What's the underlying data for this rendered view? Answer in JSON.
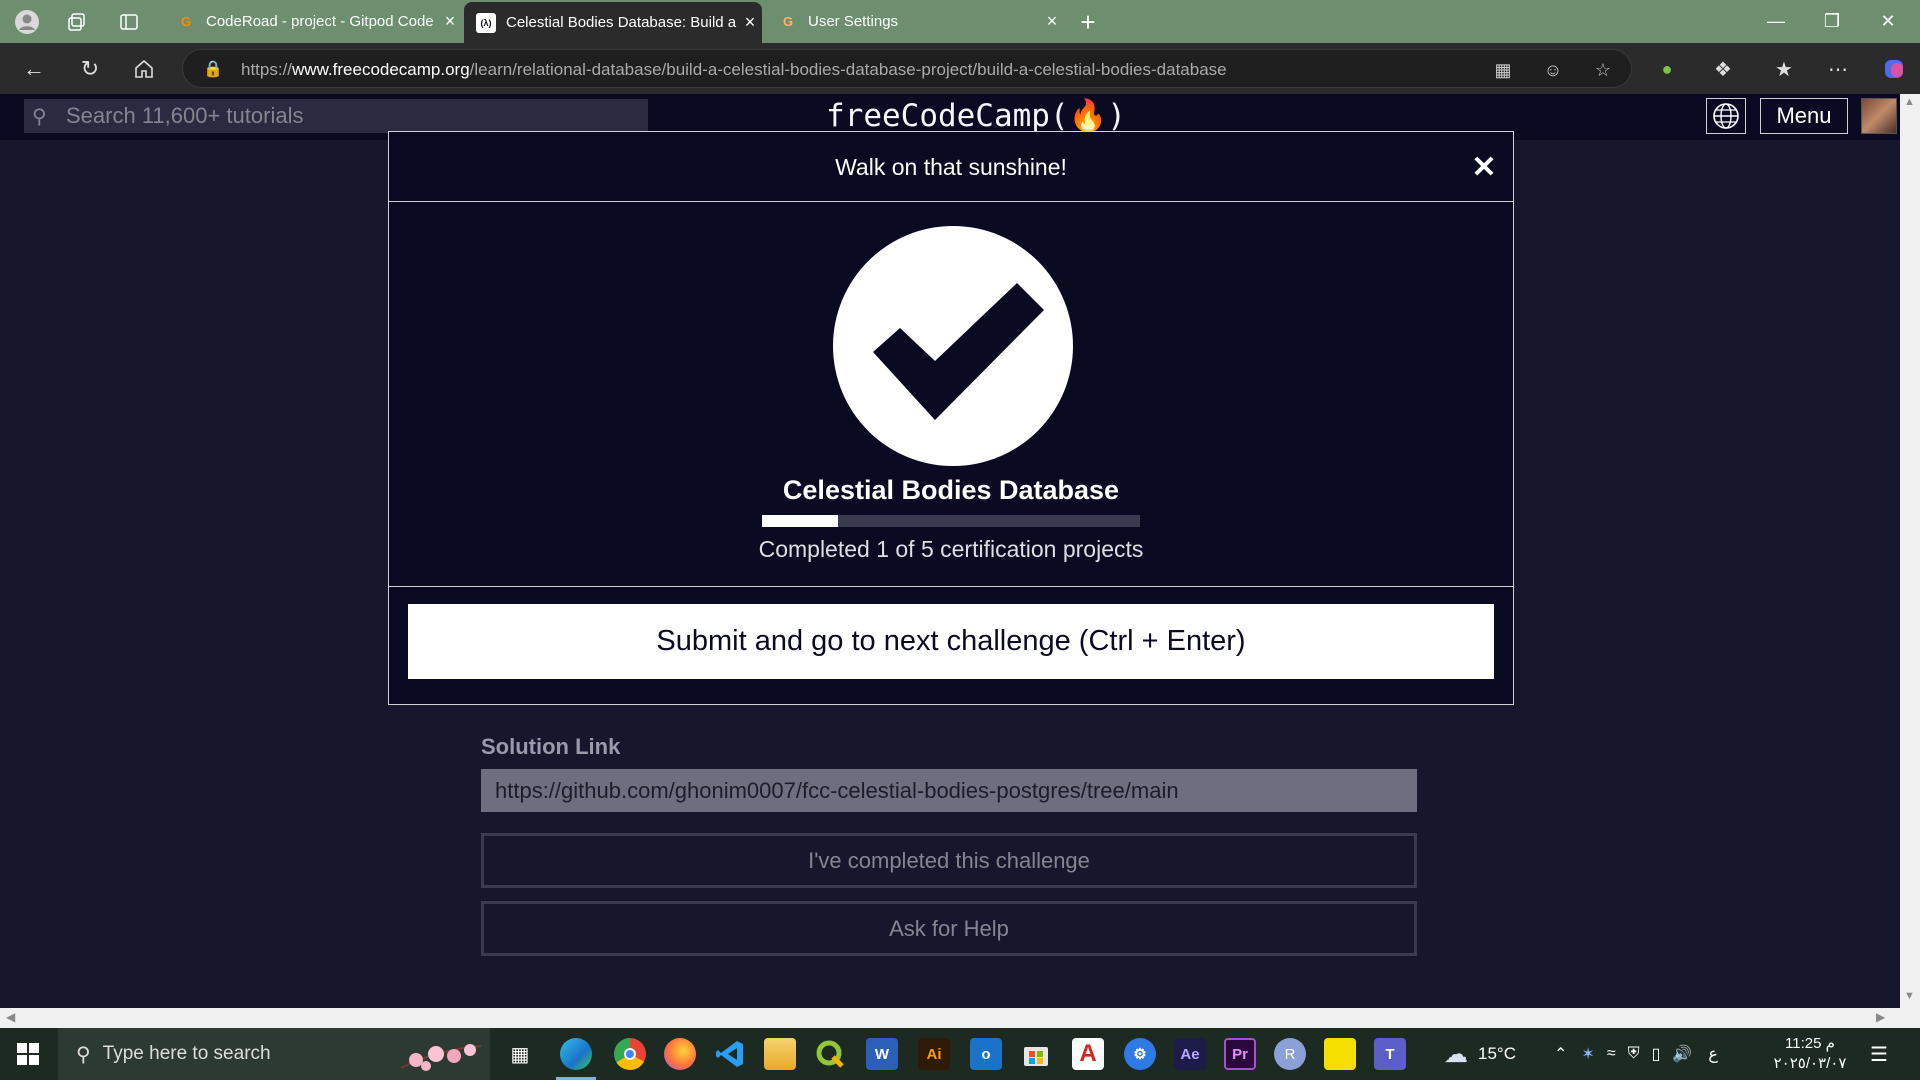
{
  "browser": {
    "tabs": [
      {
        "title": "CodeRoad - project - Gitpod Code",
        "close": "×"
      },
      {
        "title": "Celestial Bodies Database: Build a",
        "close": "×",
        "favicon": "(λ)"
      },
      {
        "title": "User Settings",
        "close": "×"
      }
    ],
    "new_tab": "+",
    "url_protocol": "https://",
    "url_host": "www.freecodecamp.org",
    "url_path": "/learn/relational-database/build-a-celestial-bodies-database-project/build-a-celestial-bodies-database"
  },
  "fcc": {
    "search_placeholder": "Search 11,600+ tutorials",
    "logo": "freeCodeCamp(🔥)",
    "menu_label": "Menu"
  },
  "modal": {
    "title": "Walk on that sunshine!",
    "project_title": "Celestial Bodies Database",
    "progress_text": "Completed 1 of 5 certification projects",
    "progress_fraction": 0.2,
    "submit_label": "Submit and go to next challenge (Ctrl + Enter)"
  },
  "page": {
    "solution_label": "Solution Link",
    "solution_value": "https://github.com/ghonim0007/fcc-celestial-bodies-postgres/tree/main",
    "completed_button": "I've completed this challenge",
    "help_button": "Ask for Help"
  },
  "taskbar": {
    "search_placeholder": "Type here to search",
    "apps": [
      "task-view",
      "edge",
      "chrome",
      "firefox",
      "vscode",
      "file-explorer",
      "qgis",
      "word",
      "illustrator",
      "outlook",
      "store",
      "acrobat",
      "app-blue",
      "after-effects",
      "premiere",
      "r",
      "sticky-notes",
      "teams"
    ],
    "app_labels": {
      "word": "W",
      "illustrator": "Ai",
      "outlook": "o",
      "acrobat": "A",
      "after-effects": "Ae",
      "premiere": "Pr",
      "r": "R",
      "teams": "T"
    },
    "weather": "15°C",
    "lang": "ع",
    "time": "11:25 م",
    "date": "٢٠٢٥/٠٣/٠٧"
  }
}
